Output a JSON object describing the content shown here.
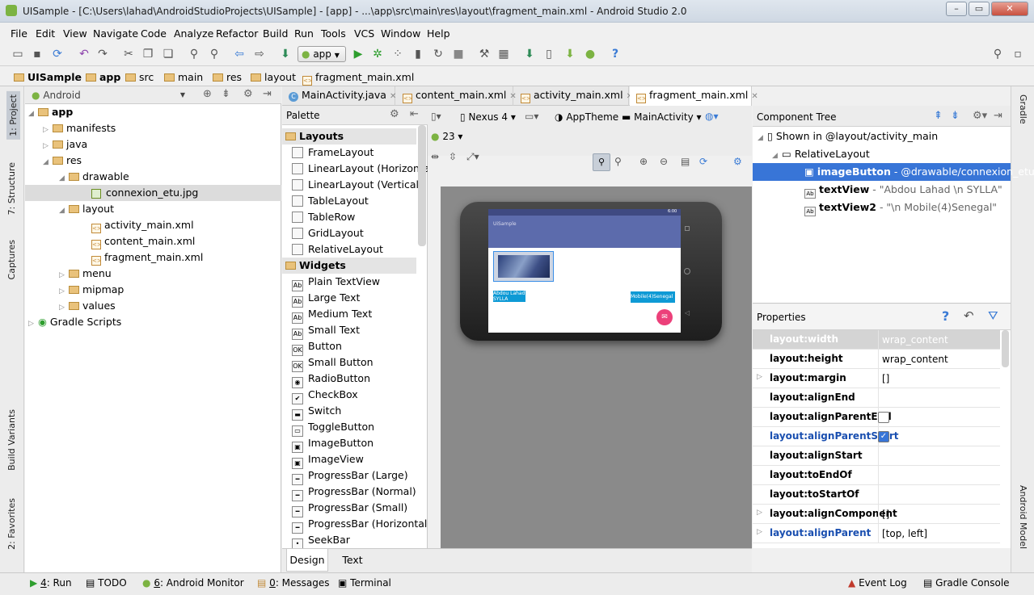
{
  "window": {
    "title": "UISample - [C:\\Users\\lahad\\AndroidStudioProjects\\UISample] - [app] - ...\\app\\src\\main\\res\\layout\\fragment_main.xml - Android Studio 2.0"
  },
  "menu": [
    "File",
    "Edit",
    "View",
    "Navigate",
    "Code",
    "Analyze",
    "Refactor",
    "Build",
    "Run",
    "Tools",
    "VCS",
    "Window",
    "Help"
  ],
  "toolbar": {
    "run_config": "app"
  },
  "breadcrumb": [
    "UISample",
    "app",
    "src",
    "main",
    "res",
    "layout",
    "fragment_main.xml"
  ],
  "left_tool_tabs": [
    "1: Project",
    "7: Structure",
    "Captures",
    "Build Variants",
    "2: Favorites"
  ],
  "right_tool_tabs": [
    "Gradle",
    "Android Model"
  ],
  "project": {
    "view_mode": "Android",
    "tree": [
      {
        "label": "app",
        "bold": true
      },
      {
        "label": "manifests"
      },
      {
        "label": "java"
      },
      {
        "label": "res"
      },
      {
        "label": "drawable"
      },
      {
        "label": "connexion_etu.jpg"
      },
      {
        "label": "layout"
      },
      {
        "label": "activity_main.xml"
      },
      {
        "label": "content_main.xml"
      },
      {
        "label": "fragment_main.xml"
      },
      {
        "label": "menu"
      },
      {
        "label": "mipmap"
      },
      {
        "label": "values"
      },
      {
        "label": "Gradle Scripts"
      }
    ]
  },
  "editor_tabs": [
    "MainActivity.java",
    "content_main.xml",
    "activity_main.xml",
    "fragment_main.xml"
  ],
  "palette": {
    "title": "Palette",
    "sections": [
      {
        "name": "Layouts",
        "items": [
          "FrameLayout",
          "LinearLayout (Horizontal)",
          "LinearLayout (Vertical)",
          "TableLayout",
          "TableRow",
          "GridLayout",
          "RelativeLayout"
        ]
      },
      {
        "name": "Widgets",
        "items": [
          "Plain TextView",
          "Large Text",
          "Medium Text",
          "Small Text",
          "Button",
          "Small Button",
          "RadioButton",
          "CheckBox",
          "Switch",
          "ToggleButton",
          "ImageButton",
          "ImageView",
          "ProgressBar (Large)",
          "ProgressBar (Normal)",
          "ProgressBar (Small)",
          "ProgressBar (Horizontal)",
          "SeekBar"
        ]
      }
    ]
  },
  "palette_icons": [
    "Ab",
    "Ab",
    "Ab",
    "Ab",
    "OK",
    "OK",
    "◉",
    "✔",
    "▬",
    "▭",
    "▣",
    "▣",
    "━",
    "━",
    "━",
    "━",
    "•"
  ],
  "designer": {
    "device": "Nexus 4",
    "theme": "AppTheme",
    "activity": "MainActivity",
    "api": "23",
    "phone": {
      "time": "6:00",
      "app_title": "UiSample",
      "text1": "Abdou Lahad SYLLA",
      "text2": "Mobile(4)Senegal"
    }
  },
  "bottom_tabs": [
    "Design",
    "Text"
  ],
  "component_tree": {
    "title": "Component Tree",
    "items": [
      {
        "label": "Shown in @layout/activity_main",
        "detail": ""
      },
      {
        "label": "RelativeLayout",
        "detail": ""
      },
      {
        "label": "imageButton",
        "detail": " - @drawable/connexion_etu",
        "selected": true
      },
      {
        "label": "textView",
        "detail": " - \"Abdou Lahad \\n SYLLA\""
      },
      {
        "label": "textView2",
        "detail": " - \"\\n Mobile(4)Senegal\""
      }
    ]
  },
  "properties": {
    "title": "Properties",
    "rows": [
      {
        "name": "layout:width",
        "value": "wrap_content"
      },
      {
        "name": "layout:height",
        "value": "wrap_content"
      },
      {
        "name": "layout:margin",
        "value": "[]"
      },
      {
        "name": "layout:alignEnd",
        "value": ""
      },
      {
        "name": "layout:alignParentEnd",
        "value": ""
      },
      {
        "name": "layout:alignParentStart",
        "value": ""
      },
      {
        "name": "layout:alignStart",
        "value": ""
      },
      {
        "name": "layout:toEndOf",
        "value": ""
      },
      {
        "name": "layout:toStartOf",
        "value": ""
      },
      {
        "name": "layout:alignComponent",
        "value": "[]"
      },
      {
        "name": "layout:alignParent",
        "value": "[top, left]"
      }
    ]
  },
  "statusbar": {
    "left": [
      {
        "num": "4",
        "text": ": Run"
      },
      {
        "num": "",
        "text": "TODO"
      },
      {
        "num": "6",
        "text": ": Android Monitor"
      },
      {
        "num": "0",
        "text": ": Messages"
      },
      {
        "num": "",
        "text": "Terminal"
      }
    ],
    "right": [
      "Event Log",
      "Gradle Console"
    ]
  }
}
